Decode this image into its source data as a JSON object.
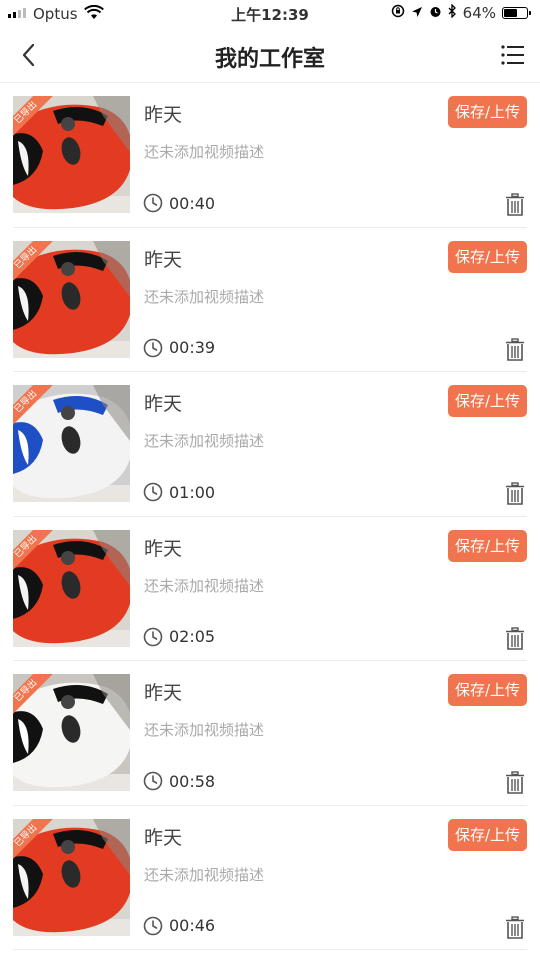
{
  "status_bar": {
    "carrier": "Optus",
    "time": "上午12:39",
    "battery_percent": "64%",
    "battery_level": 0.64
  },
  "header": {
    "title": "我的工作室",
    "back_icon": "chevron-left-icon",
    "menu_icon": "list-icon"
  },
  "colors": {
    "accent": "#f0754f"
  },
  "videos": [
    {
      "badge": "已导出",
      "day": "昨天",
      "description": "还未添加视频描述",
      "duration": "00:40",
      "action": "保存/上传",
      "mask": "red"
    },
    {
      "badge": "已导出",
      "day": "昨天",
      "description": "还未添加视频描述",
      "duration": "00:39",
      "action": "保存/上传",
      "mask": "red"
    },
    {
      "badge": "已导出",
      "day": "昨天",
      "description": "还未添加视频描述",
      "duration": "01:00",
      "action": "保存/上传",
      "mask": "blue"
    },
    {
      "badge": "已导出",
      "day": "昨天",
      "description": "还未添加视频描述",
      "duration": "02:05",
      "action": "保存/上传",
      "mask": "red"
    },
    {
      "badge": "已导出",
      "day": "昨天",
      "description": "还未添加视频描述",
      "duration": "00:58",
      "action": "保存/上传",
      "mask": "black"
    },
    {
      "badge": "已导出",
      "day": "昨天",
      "description": "还未添加视频描述",
      "duration": "00:46",
      "action": "保存/上传",
      "mask": "red"
    }
  ]
}
